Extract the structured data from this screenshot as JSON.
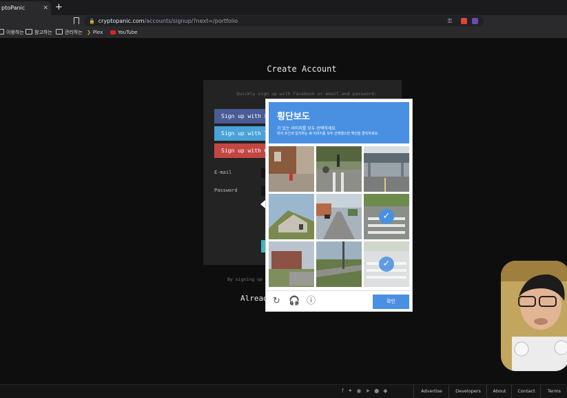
{
  "browser": {
    "tab_title": "ptoPanic",
    "tab_close": "✕",
    "new_tab": "+",
    "url_host": "cryptopanic.com",
    "url_path": "/accounts/signup/?next=/portfolio",
    "bookmarks": [
      "이용하는",
      "참고하는",
      "관리하는",
      "Plex",
      "YouTube"
    ]
  },
  "page": {
    "title": "Create Account",
    "quick_text": "Quickly sign up with Facebook or email and password:",
    "facebook_button": "Sign up with F",
    "twitter_button": "Sign up with T",
    "google_button": "Sign up with G",
    "email_label": "E-mail",
    "password_label": "Password",
    "by_signing": "By signing up",
    "already": "Alread"
  },
  "captcha": {
    "title": "횡단보도",
    "subtitle": "가 있는 이미지를 모두 선택하세요",
    "instruction": "위의 조건과 일치하는 새 이미지를 모두 선택했으면 확인을 클릭하세요.",
    "verify_button": "확인",
    "tiles": [
      {
        "scene": "street-hydrant",
        "selected": false
      },
      {
        "scene": "street-cyclist",
        "selected": false
      },
      {
        "scene": "overpass",
        "selected": false
      },
      {
        "scene": "hill-building",
        "selected": false
      },
      {
        "scene": "road-cars",
        "selected": false
      },
      {
        "scene": "crosswalk",
        "selected": true
      },
      {
        "scene": "building-lot",
        "selected": false
      },
      {
        "scene": "highway-pole",
        "selected": false
      },
      {
        "scene": "crosswalk-faded",
        "selected": true
      }
    ]
  },
  "footer": {
    "links": [
      "Advertise",
      "Developers",
      "About",
      "Contact",
      "Terms"
    ],
    "social_icons": [
      "facebook-icon",
      "twitter-icon",
      "discord-icon",
      "telegram-icon",
      "apple-icon",
      "android-icon"
    ]
  }
}
